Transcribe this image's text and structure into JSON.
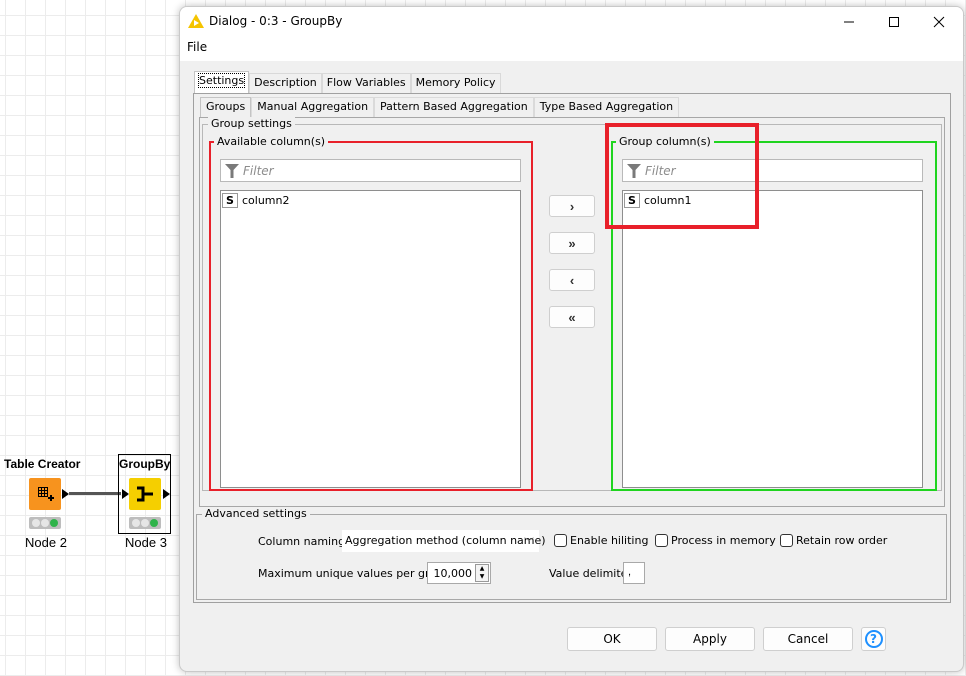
{
  "canvas": {
    "nodes": [
      {
        "title": "Table Creator",
        "label": "Node 2",
        "color": "#f7931e",
        "status": [
          "off",
          "off",
          "green"
        ]
      },
      {
        "title": "GroupBy",
        "label": "Node 3",
        "color": "#f5cf00",
        "status": [
          "off",
          "off",
          "green"
        ]
      }
    ]
  },
  "dialog": {
    "title": "Dialog - 0:3 - GroupBy",
    "menu": {
      "file": "File"
    },
    "window_controls": {
      "minimize": "—",
      "maximize": "☐",
      "close": "✕"
    },
    "tabs": [
      {
        "label": "Settings",
        "active": true
      },
      {
        "label": "Description",
        "active": false
      },
      {
        "label": "Flow Variables",
        "active": false
      },
      {
        "label": "Memory Policy",
        "active": false
      }
    ],
    "subtabs": [
      {
        "label": "Groups",
        "active": true
      },
      {
        "label": "Manual Aggregation",
        "active": false
      },
      {
        "label": "Pattern Based Aggregation",
        "active": false
      },
      {
        "label": "Type Based Aggregation",
        "active": false
      }
    ],
    "group_settings": {
      "legend": "Group settings",
      "available": {
        "legend": "Available column(s)",
        "filter_placeholder": "Filter",
        "items": [
          {
            "type": "S",
            "name": "column2"
          }
        ],
        "border_color": "#e8202a"
      },
      "group": {
        "legend": "Group column(s)",
        "filter_placeholder": "Filter",
        "items": [
          {
            "type": "S",
            "name": "column1"
          }
        ],
        "border_color": "#1fd41f"
      },
      "move_buttons": {
        "add": "›",
        "add_all": "»",
        "remove": "‹",
        "remove_all": "«"
      }
    },
    "advanced_settings": {
      "legend": "Advanced settings",
      "column_naming_label": "Column naming:",
      "column_naming_value": "Aggregation method (column name)",
      "enable_hiliting": {
        "label": "Enable hiliting",
        "checked": false
      },
      "process_in_memory": {
        "label": "Process in memory",
        "checked": false
      },
      "retain_row_order": {
        "label": "Retain row order",
        "checked": false
      },
      "max_unique_label": "Maximum unique values per group",
      "max_unique_value": "10,000",
      "value_delimiter_label": "Value delimiter",
      "value_delimiter_value": ","
    },
    "footer": {
      "ok": "OK",
      "apply": "Apply",
      "cancel": "Cancel",
      "help": "?"
    }
  }
}
